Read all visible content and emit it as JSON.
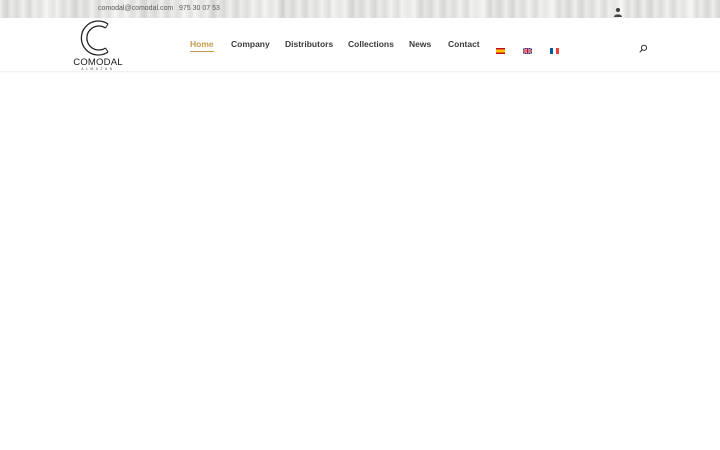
{
  "topbar": {
    "email": "comodal@comodal.com",
    "phone": "975 30 07 53",
    "user_icon": "user-icon"
  },
  "logo": {
    "brand": "COMODAL",
    "subtitle": "ALMAZAN"
  },
  "nav": {
    "items": [
      {
        "label": "Home",
        "active": true
      },
      {
        "label": "Company"
      },
      {
        "label": "Distributors"
      },
      {
        "label": "Collections"
      },
      {
        "label": "News"
      },
      {
        "label": "Contact"
      }
    ],
    "languages": [
      "spanish-flag-icon",
      "uk-flag-icon",
      "french-flag-icon"
    ],
    "search_icon": "search-icon"
  },
  "colors": {
    "accent": "#c59a4a",
    "nav_text": "#3a3a3a"
  }
}
